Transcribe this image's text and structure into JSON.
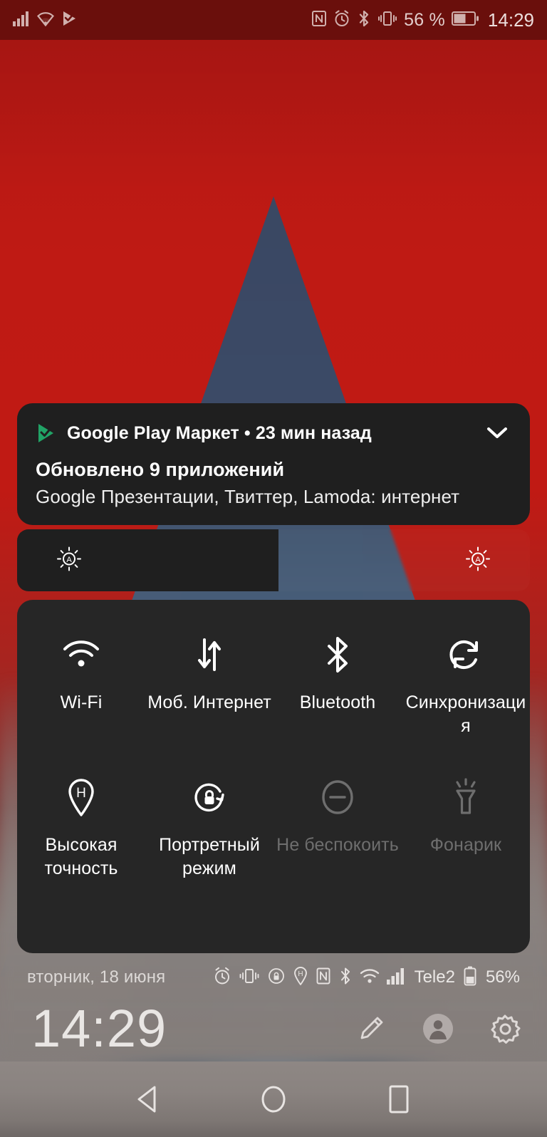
{
  "status_bar": {
    "left_icons": [
      "signal-bars-icon",
      "wifi-icon",
      "play-store-update-icon"
    ],
    "right_icons": [
      "nfc-icon",
      "alarm-icon",
      "bluetooth-icon",
      "vibrate-icon"
    ],
    "battery_percent": "56 %",
    "time": "14:29"
  },
  "notification": {
    "app_icon": "google-play-icon",
    "app_name": "Google Play Маркет",
    "separator": "•",
    "time_ago": "23 мин назад",
    "title": "Обновлено 9 приложений",
    "summary": "Google Презентации, Твиттер, Lamoda: интернет",
    "expand_icon": "chevron-down-icon"
  },
  "brightness": {
    "icon_left": "auto-brightness-icon",
    "icon_right": "auto-brightness-icon",
    "value_percent": 51
  },
  "quick_settings": {
    "rows": [
      [
        {
          "icon": "wifi-icon",
          "label": "Wi-Fi",
          "enabled": true
        },
        {
          "icon": "mobile-data-icon",
          "label": "Моб. Интернет",
          "enabled": true
        },
        {
          "icon": "bluetooth-icon",
          "label": "Bluetooth",
          "enabled": true
        },
        {
          "icon": "sync-icon",
          "label": "Синхронизация",
          "enabled": true
        }
      ],
      [
        {
          "icon": "location-high-accuracy-icon",
          "label": "Высокая точность",
          "enabled": true
        },
        {
          "icon": "rotation-lock-icon",
          "label": "Портретный режим",
          "enabled": true
        },
        {
          "icon": "do-not-disturb-icon",
          "label": "Не беспокоить",
          "enabled": false
        },
        {
          "icon": "flashlight-icon",
          "label": "Фонарик",
          "enabled": false
        }
      ]
    ]
  },
  "bottom_status": {
    "date": "вторник, 18 июня",
    "icons": [
      "alarm-icon",
      "vibrate-icon",
      "rotation-lock-icon",
      "location-icon",
      "nfc-icon",
      "bluetooth-icon",
      "wifi-icon",
      "signal-bars-icon"
    ],
    "carrier": "Tele2",
    "battery_percent": "56%"
  },
  "clock_row": {
    "time": "14:29",
    "actions": [
      "edit-pencil-icon",
      "user-avatar-icon",
      "settings-gear-icon"
    ]
  },
  "nav_bar": {
    "buttons": [
      "back-button",
      "home-button",
      "recents-button"
    ]
  },
  "colors": {
    "status_bar_bg": "#6a0f0c",
    "panel_bg": "#262626",
    "notification_bg": "#1f1f1f",
    "accent_green": "#21a366",
    "text_primary": "#ffffff",
    "text_disabled": "#6e6e6e",
    "wallpaper_red": "#bf1a14",
    "wallpaper_blue": "#31506f"
  }
}
